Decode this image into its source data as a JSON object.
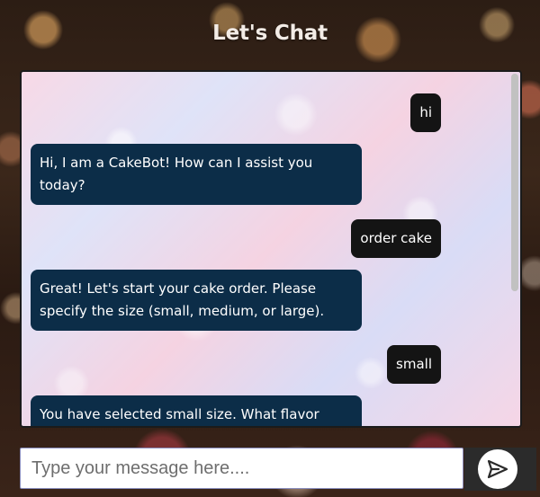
{
  "header": {
    "title": "Let's Chat"
  },
  "chat": {
    "messages": [
      {
        "sender": "user",
        "text": "hi"
      },
      {
        "sender": "bot",
        "text": "Hi, I am a CakeBot! How can I assist you today?"
      },
      {
        "sender": "user",
        "text": "order cake"
      },
      {
        "sender": "bot",
        "text": "Great! Let's start your cake order. Please specify the size (small, medium, or large)."
      },
      {
        "sender": "user",
        "text": "small"
      },
      {
        "sender": "bot",
        "text": "You have selected small size. What flavor"
      }
    ]
  },
  "input": {
    "placeholder": "Type your message here....",
    "value": ""
  },
  "send": {
    "icon": "paper-plane-icon"
  },
  "colors": {
    "bot_bubble": "#0c2d48",
    "user_bubble": "#141414",
    "send_bg": "#2b2b2b"
  }
}
